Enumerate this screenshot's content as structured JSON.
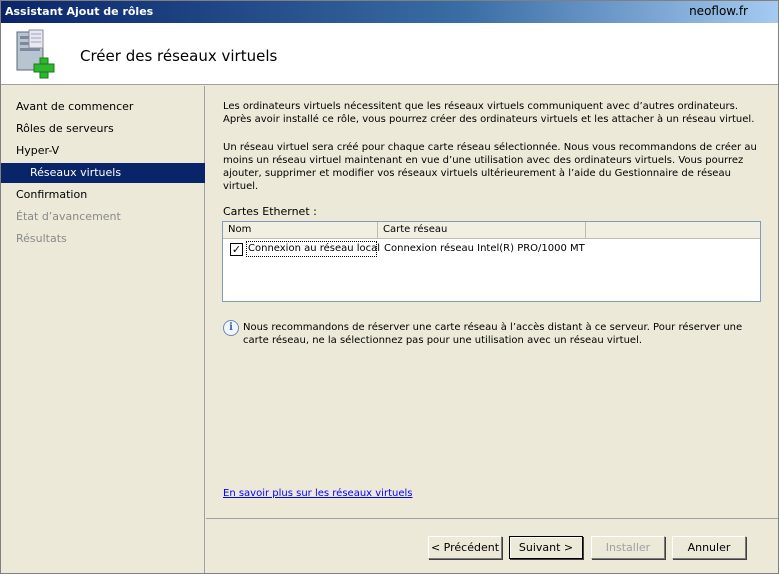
{
  "window": {
    "title": "Assistant Ajout de rôles",
    "watermark": "neoflow.fr"
  },
  "header": {
    "title": "Créer des réseaux virtuels",
    "icon": "server-add-icon"
  },
  "sidebar": {
    "items": [
      {
        "label": "Avant de commencer",
        "state": "normal"
      },
      {
        "label": "Rôles de serveurs",
        "state": "normal"
      },
      {
        "label": "Hyper-V",
        "state": "normal"
      },
      {
        "label": "Réseaux virtuels",
        "state": "active"
      },
      {
        "label": "Confirmation",
        "state": "normal"
      },
      {
        "label": "État d’avancement",
        "state": "disabled"
      },
      {
        "label": "Résultats",
        "state": "disabled"
      }
    ]
  },
  "content": {
    "para1": "Les ordinateurs virtuels nécessitent que les réseaux virtuels communiquent avec d’autres ordinateurs. Après avoir installé ce rôle, vous pourrez créer des ordinateurs virtuels et les attacher à un réseau virtuel.",
    "para2": "Un réseau virtuel sera créé pour chaque carte réseau sélectionnée. Nous vous recommandons de créer au moins un réseau virtuel maintenant en vue d’une utilisation avec des ordinateurs virtuels. Vous pourrez ajouter, supprimer et modifier vos réseaux virtuels ultérieurement à l’aide du Gestionnaire de réseau virtuel.",
    "cards_label": "Cartes Ethernet :",
    "table": {
      "columns": [
        "Nom",
        "Carte réseau"
      ],
      "rows": [
        {
          "checked": true,
          "name": "Connexion au réseau local",
          "adapter": "Connexion réseau Intel(R) PRO/1000 MT"
        }
      ]
    },
    "info_text": "Nous recommandons de réserver une carte réseau à l’accès distant à ce serveur. Pour réserver une carte réseau, ne la sélectionnez pas pour une utilisation avec un réseau virtuel.",
    "link": "En savoir plus sur les réseaux virtuels"
  },
  "footer": {
    "prev": "< Précédent",
    "next": "Suivant >",
    "install": "Installer",
    "cancel": "Annuler"
  },
  "colors": {
    "title_bar": "#0a246a",
    "selection": "#0a246a",
    "link": "#0000ff"
  }
}
